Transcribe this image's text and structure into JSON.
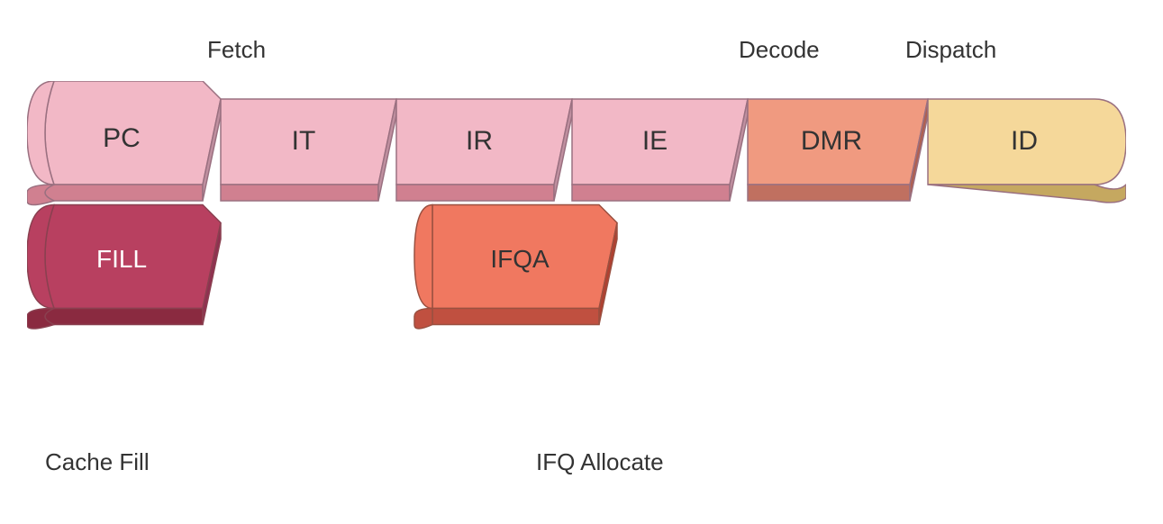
{
  "labels": {
    "fetch": "Fetch",
    "decode": "Decode",
    "dispatch": "Dispatch",
    "cache_fill": "Cache Fill",
    "ifq_allocate": "IFQ Allocate"
  },
  "stages": {
    "top_row": [
      "PC",
      "IT",
      "IR",
      "IE",
      "DMR",
      "ID"
    ],
    "sub_row": [
      "FILL",
      "IFQA"
    ]
  },
  "colors": {
    "pc_fill": "#f2b8c6",
    "pc_side": "#c97a8a",
    "it_fill": "#f2b8c6",
    "it_side": "#c97a8a",
    "ir_fill": "#f2b8c6",
    "ir_side": "#c97a8a",
    "ie_fill": "#f2b8c6",
    "ie_side": "#c97a8a",
    "dmr_fill": "#f09a80",
    "dmr_side": "#c0705a",
    "id_fill": "#f5d89a",
    "id_side": "#c5a860",
    "fill_fill": "#b84060",
    "fill_side": "#8a2a40",
    "ifqa_fill": "#f07860",
    "ifqa_side": "#c05040",
    "stroke": "#8a6a70"
  }
}
